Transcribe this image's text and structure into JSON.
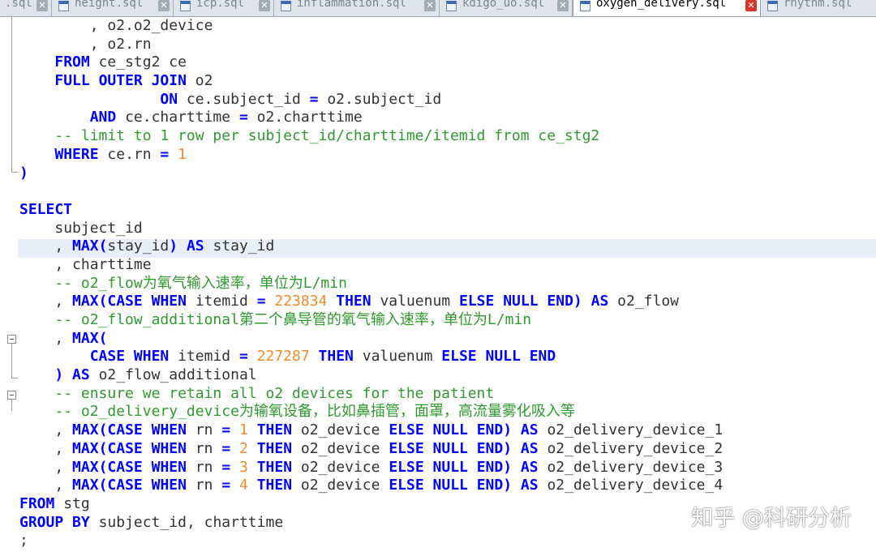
{
  "tabs": [
    {
      "label": ".sql",
      "active": false
    },
    {
      "label": "height.sql",
      "active": false
    },
    {
      "label": "icp.sql",
      "active": false
    },
    {
      "label": "inflammation.sql",
      "active": false
    },
    {
      "label": "kdigo_uo.sql",
      "active": false
    },
    {
      "label": "oxygen_delivery.sql",
      "active": true
    },
    {
      "label": "rhythm.sql",
      "active": false
    }
  ],
  "code_lines": [
    "        , o2.o2_device",
    "        , o2.rn",
    "    FROM ce_stg2 ce",
    "    FULL OUTER JOIN o2",
    "                ON ce.subject_id = o2.subject_id",
    "        AND ce.charttime = o2.charttime",
    "    -- limit to 1 row per subject_id/charttime/itemid from ce_stg2",
    "    WHERE ce.rn = 1",
    ")",
    "",
    "SELECT",
    "    subject_id",
    "    , MAX(stay_id) AS stay_id",
    "    , charttime",
    "    -- o2_flow为氧气输入速率，单位为L/min",
    "    , MAX(CASE WHEN itemid = 223834 THEN valuenum ELSE NULL END) AS o2_flow",
    "    -- o2_flow_additional第二个鼻导管的氧气输入速率，单位为L/min",
    "    , MAX(",
    "        CASE WHEN itemid = 227287 THEN valuenum ELSE NULL END",
    "    ) AS o2_flow_additional",
    "    -- ensure we retain all o2 devices for the patient",
    "    -- o2_delivery_device为输氧设备，比如鼻插管，面罩，高流量雾化吸入等",
    "    , MAX(CASE WHEN rn = 1 THEN o2_device ELSE NULL END) AS o2_delivery_device_1",
    "    , MAX(CASE WHEN rn = 2 THEN o2_device ELSE NULL END) AS o2_delivery_device_2",
    "    , MAX(CASE WHEN rn = 3 THEN o2_device ELSE NULL END) AS o2_delivery_device_3",
    "    , MAX(CASE WHEN rn = 4 THEN o2_device ELSE NULL END) AS o2_delivery_device_4",
    "FROM stg",
    "GROUP BY subject_id, charttime",
    ";"
  ],
  "watermark": "知乎 @科研分析",
  "colors": {
    "keyword": "#0000ff",
    "comment": "#2f9a2f",
    "number": "#f08c28",
    "identifier": "#333333",
    "current_line": "#e9effa",
    "close_active": "#d9342b"
  }
}
